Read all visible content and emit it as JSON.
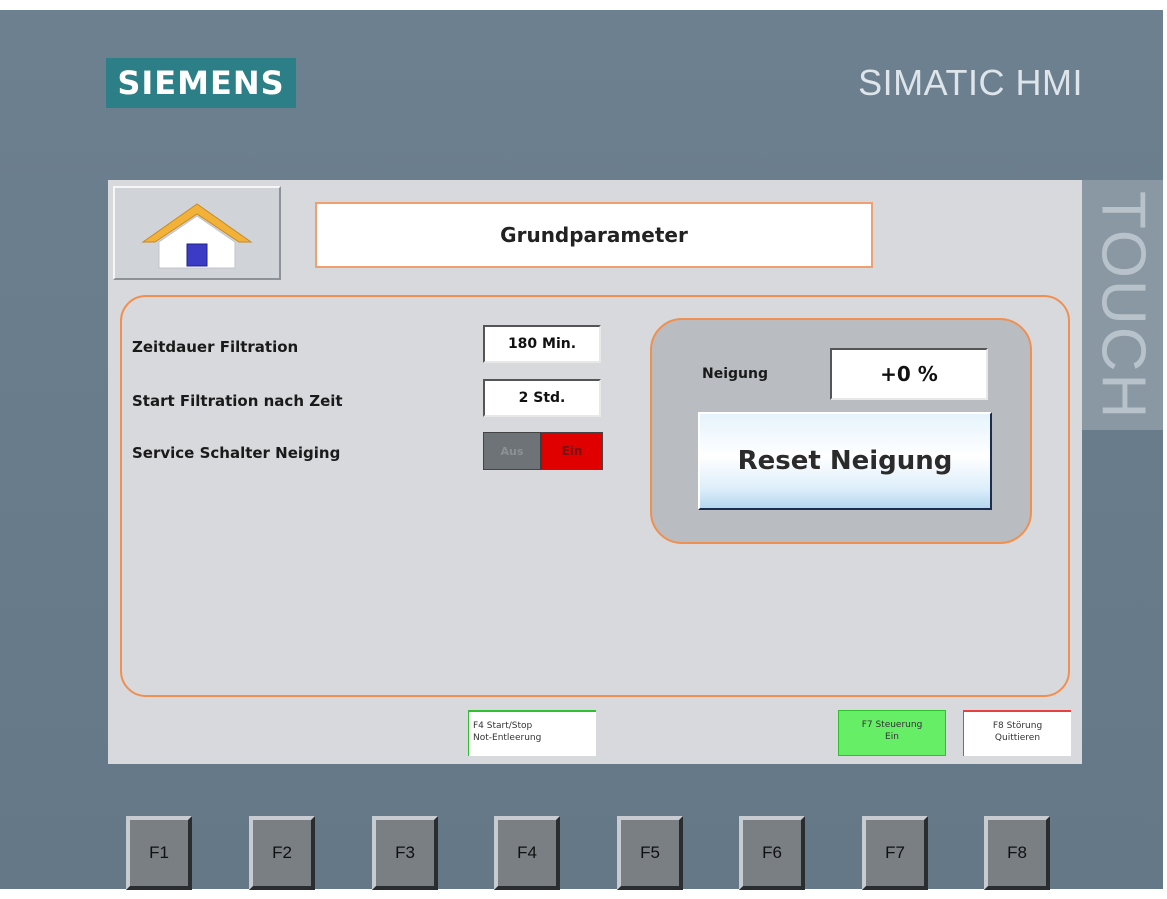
{
  "bezel": {
    "brand": "SIEMENS",
    "product": "SIMATIC HMI",
    "touch_label": "TOUCH"
  },
  "header": {
    "home_icon": "house-icon",
    "title": "Grundparameter"
  },
  "parameters": {
    "filtration_duration": {
      "label": "Zeitdauer Filtration",
      "value": "180 Min."
    },
    "filtration_start": {
      "label": "Start Filtration nach Zeit",
      "value": "2 Std."
    },
    "service_switch": {
      "label": "Service Schalter Neiging",
      "off_text": "Aus",
      "on_text": "Ein",
      "state": "Ein"
    }
  },
  "tilt": {
    "label": "Neigung",
    "value": "+0 %",
    "reset_button": "Reset Neigung"
  },
  "function_labels": {
    "f4_line1": "F4 Start/Stop",
    "f4_line2": "Not-Entleerung",
    "f7_line1": "F7 Steuerung",
    "f7_line2": "Ein",
    "f8_line1": "F8 Störung",
    "f8_line2": "Quittieren"
  },
  "hardware_keys": [
    "F1",
    "F2",
    "F3",
    "F4",
    "F5",
    "F6",
    "F7",
    "F8"
  ],
  "colors": {
    "panel_accent": "#f09050",
    "switch_on": "#e00000",
    "f7_active": "#66ee66",
    "brand": "#2c7f86"
  }
}
